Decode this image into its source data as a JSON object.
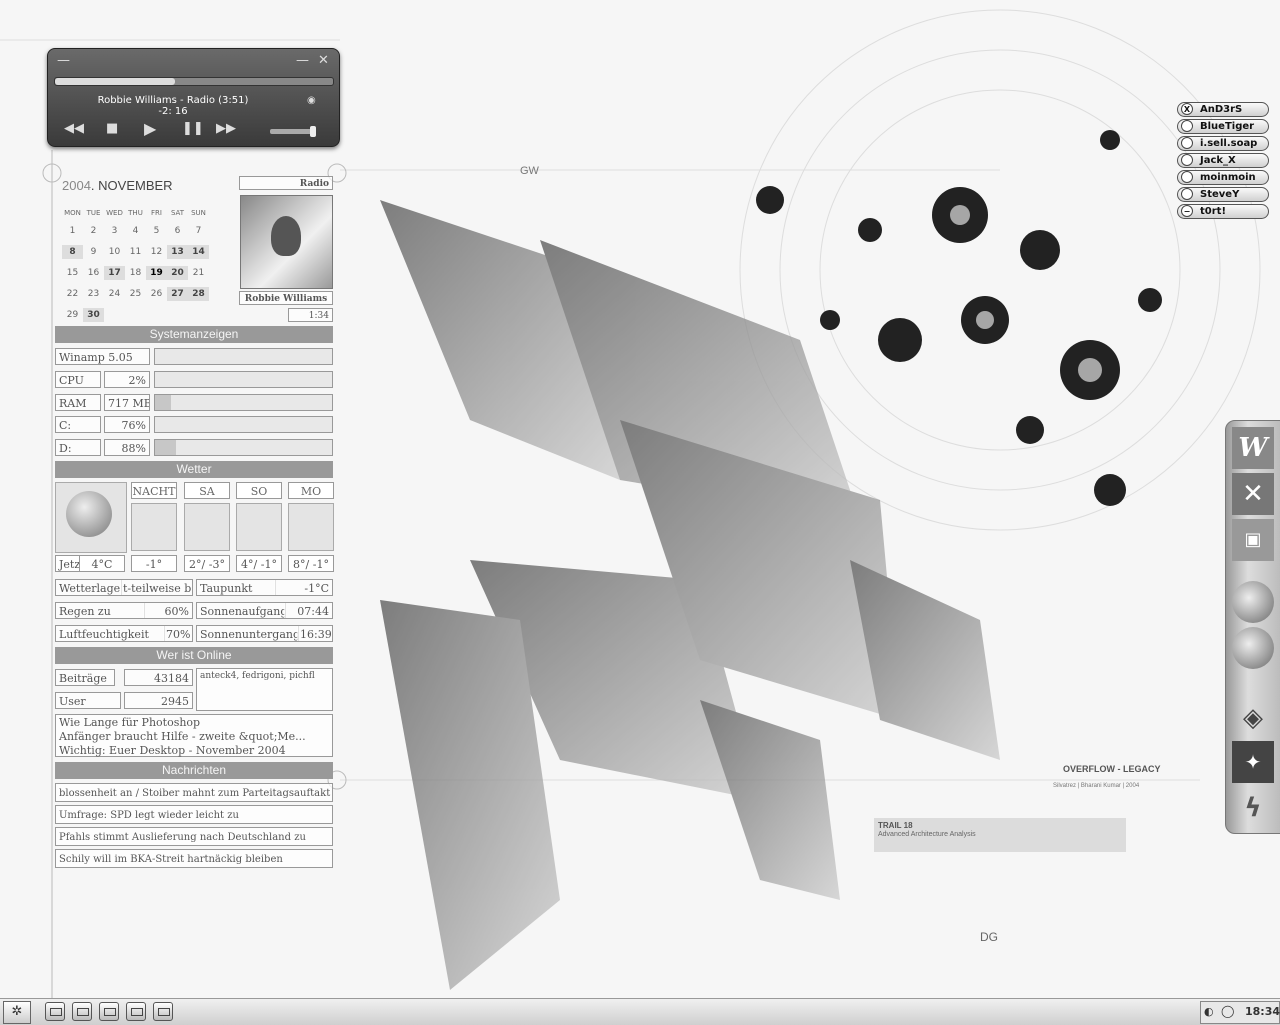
{
  "player": {
    "track": "Robbie  Williams - Radio (3:51)",
    "remaining": "-2: 16",
    "progress": 0.43,
    "volume": 0.9,
    "minimize_icon": "minimize-icon",
    "close_icon": "close-icon",
    "controls": [
      "previous",
      "stop",
      "play",
      "pause",
      "next"
    ]
  },
  "calendar": {
    "year": "2004",
    "month": "NOVEMBER",
    "days_of_week": [
      "MON",
      "TUE",
      "WED",
      "THU",
      "FRI",
      "SAT",
      "SUN"
    ],
    "weeks": [
      [
        "1",
        "2",
        "3",
        "4",
        "5",
        "6",
        "7"
      ],
      [
        "8",
        "9",
        "10",
        "11",
        "12",
        "13",
        "14"
      ],
      [
        "15",
        "16",
        "17",
        "18",
        "19",
        "20",
        "21"
      ],
      [
        "22",
        "23",
        "24",
        "25",
        "26",
        "27",
        "28"
      ],
      [
        "29",
        "30",
        "",
        "",
        "",
        "",
        ""
      ]
    ],
    "today": "19"
  },
  "now_playing": {
    "label": "Radio",
    "artist": "Robbie  Williams",
    "time": "1:34"
  },
  "system": {
    "heading": "Systemanzeigen",
    "winamp": "Winamp  5.05",
    "cpu_label": "CPU",
    "cpu_value": "2%",
    "ram_label": "RAM",
    "ram_value": "717 MB",
    "c_label": "C:",
    "c_value": "76%",
    "d_label": "D:",
    "d_value": "88%",
    "ram_fill": 0.09,
    "d_fill": 0.12
  },
  "weather": {
    "heading": "Wetter",
    "days": [
      "NACHT",
      "SA",
      "SO",
      "MO"
    ],
    "now_label": "Jetzt",
    "now_temp": "4°C",
    "temps": [
      "-1°",
      "2°/ -3°",
      "4°/ -1°",
      "8°/ -1°"
    ],
    "condition_label": "Wetterlage",
    "condition_value": "t-teilweise b",
    "dew_label": "Taupunkt",
    "dew_value": "-1°C",
    "rain_label": "Regen zu",
    "rain_value": "60%",
    "sunrise_label": "Sonnenaufgang",
    "sunrise_value": "07:44",
    "humidity_label": "Luftfeuchtigkeit",
    "humidity_value": "70%",
    "sunset_label": "Sonnenuntergang",
    "sunset_value": "16:39"
  },
  "online": {
    "heading": "Wer ist Online",
    "posts_label": "Beiträge",
    "posts_value": "43184",
    "users_label": "User",
    "users_value": "2945",
    "who": "anteck4, fedrigoni, pichfl",
    "topics": [
      "Wie Lange für Photoshop",
      "Anfänger braucht Hilfe - zweite &quot;Me...",
      "Wichtig: Euer Desktop - November 2004"
    ]
  },
  "news": {
    "heading": "Nachrichten",
    "items": [
      "blossenheit an / Stoiber mahnt zum Parteitagsauftakt Ges",
      "Umfrage: SPD legt wieder leicht zu",
      "Pfahls stimmt Auslieferung nach Deutschland zu",
      "Schily will im BKA-Streit hartnäckig bleiben"
    ]
  },
  "buddies": [
    {
      "name": "AnD3rS",
      "status": "X"
    },
    {
      "name": "BlueTiger",
      "status": ""
    },
    {
      "name": "i.sell.soap",
      "status": ""
    },
    {
      "name": "Jack_X",
      "status": ""
    },
    {
      "name": "moinmoin",
      "status": ""
    },
    {
      "name": "SteveY",
      "status": ""
    },
    {
      "name": "t0rt!",
      "status": "−"
    }
  ],
  "wallpaper": {
    "gw": "GW",
    "dg": "DG",
    "title": "OVERFLOW - LEGACY",
    "credit": "Silvatrez | Bharani Kumar | 2004",
    "trail_title": "TRAIL 18",
    "trail_sub": "Advanced Architecture Analysis"
  },
  "dock": [
    "word-icon",
    "excel-icon",
    "powerpoint-icon",
    "firefox-icon",
    "firefox-alt-icon",
    "eclipse-icon",
    "photoshop-cs-icon",
    "flash-icon"
  ],
  "taskbar": {
    "clock": "18:34"
  }
}
